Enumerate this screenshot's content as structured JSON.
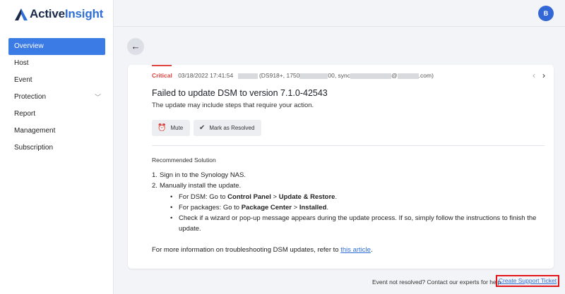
{
  "app": {
    "brand_part1": "Active",
    "brand_part2": "Insight",
    "avatar_initial": "B"
  },
  "sidebar": {
    "items": [
      {
        "label": "Overview",
        "active": true
      },
      {
        "label": "Host"
      },
      {
        "label": "Event"
      },
      {
        "label": "Protection",
        "chevron": "chevron-down-icon"
      },
      {
        "label": "Report"
      },
      {
        "label": "Management"
      },
      {
        "label": "Subscription"
      }
    ]
  },
  "event": {
    "severity": "Critical",
    "timestamp": "03/18/2022 17:41:54",
    "host_part1": "(DS918+, 1750",
    "host_part2": "00, sync",
    "host_part3": "@",
    "host_part4": ".com)",
    "title": "Failed to update DSM to version 7.1.0-42543",
    "subtitle": "The update may include steps that require your action.",
    "mute_label": "Mute",
    "resolve_label": "Mark as Resolved"
  },
  "solution": {
    "heading": "Recommended Solution",
    "step1_num": "1.",
    "step1": "Sign in to the Synology NAS.",
    "step2_num": "2.",
    "step2": "Manually install the update.",
    "bullet1_prefix": "For DSM: Go to ",
    "bullet1_a": "Control Panel",
    "bullet1_sep": " > ",
    "bullet1_b": "Update & Restore",
    "bullet1_end": ".",
    "bullet2_prefix": "For packages: Go to ",
    "bullet2_a": "Package Center",
    "bullet2_sep": " > ",
    "bullet2_b": "Installed",
    "bullet2_end": ".",
    "bullet3": "Check if a wizard or pop-up message appears during the update process. If so, simply follow the instructions to finish the update.",
    "more_prefix": "For more information on troubleshooting DSM updates, refer to ",
    "more_link": "this article",
    "more_end": "."
  },
  "footer": {
    "text": "Event not resolved? Contact our experts for help.",
    "link": "Create Support Ticket"
  },
  "colors": {
    "accent": "#3b7be6",
    "critical": "#e0453f",
    "highlight_border": "#e0161b"
  }
}
